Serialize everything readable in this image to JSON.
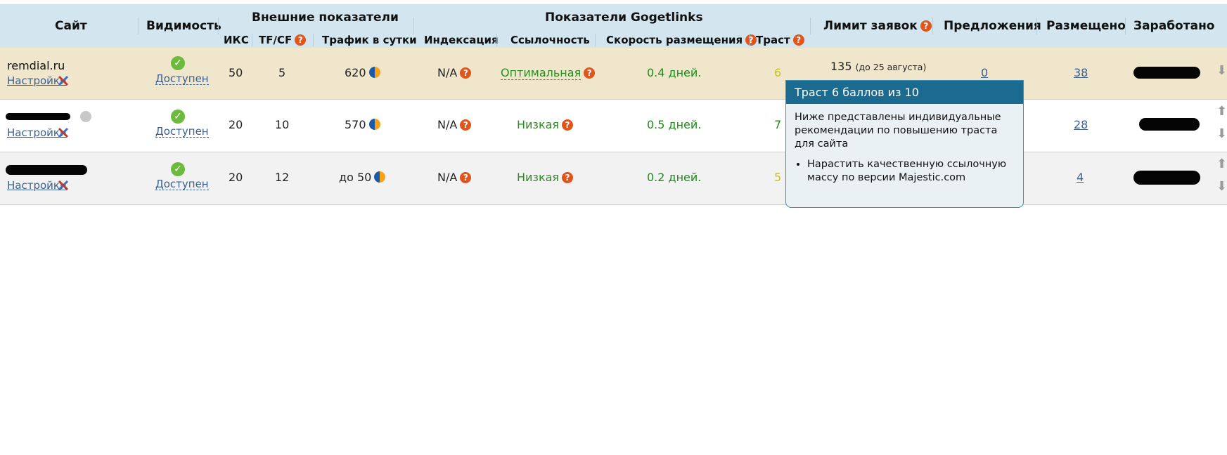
{
  "header": {
    "site": "Сайт",
    "visibility": "Видимость",
    "external_group": "Внешние показатели",
    "iks": "ИКС",
    "tfcf": "TF/CF",
    "traffic": "Трафик в сутки",
    "gogetlinks_group": "Показатели Gogetlinks",
    "indexation": "Индексация",
    "linkness": "Ссылочность",
    "speed": "Скорость размещения",
    "trust": "Траст",
    "limit": "Лимит заявок",
    "offers": "Предложения",
    "placed": "Размещено",
    "earned": "Заработано"
  },
  "rows": [
    {
      "site": "remdial.ru",
      "settings": "Настройки",
      "availability": "Доступен",
      "iks": "50",
      "tfcf": "5",
      "traffic": "620",
      "indexation": "N/A",
      "linkness": "Оптимальная",
      "speed": "0.4 дней.",
      "trust": "6",
      "limit": "135",
      "limit_note": "(до 25 августа)",
      "offers": "0",
      "placed": "38"
    },
    {
      "site": "",
      "settings": "Настройки",
      "availability": "Доступен",
      "iks": "20",
      "tfcf": "10",
      "traffic": "570",
      "indexation": "N/A",
      "linkness": "Низкая",
      "speed": "0.5 дней.",
      "trust": "7",
      "placed": "28"
    },
    {
      "site": "",
      "settings": "Настройки",
      "availability": "Доступен",
      "iks": "20",
      "tfcf": "12",
      "traffic": "до 50",
      "indexation": "N/A",
      "linkness": "Низкая",
      "speed": "0.2 дней.",
      "trust": "5",
      "placed": "4"
    }
  ],
  "tooltip": {
    "title": "Траст 6 баллов из 10",
    "text": "Ниже представлены индивидуальные рекомендации по повышению траста для сайта",
    "item": "Нарастить качественную ссылочную массу по версии Majestic.com"
  },
  "icons": {
    "help": "question-icon",
    "status": "check-icon",
    "settings": "tools-icon",
    "traffic_source": "liveinternet-icon",
    "move_up": "arrow-up-icon",
    "move_down": "arrow-down-icon"
  },
  "colors": {
    "header_bg": "#d3e5ee",
    "row_highlight": "#efe6cc",
    "tooltip_header": "#1a6b8f",
    "help_icon": "#e1541a",
    "good": "#2e8b22"
  }
}
